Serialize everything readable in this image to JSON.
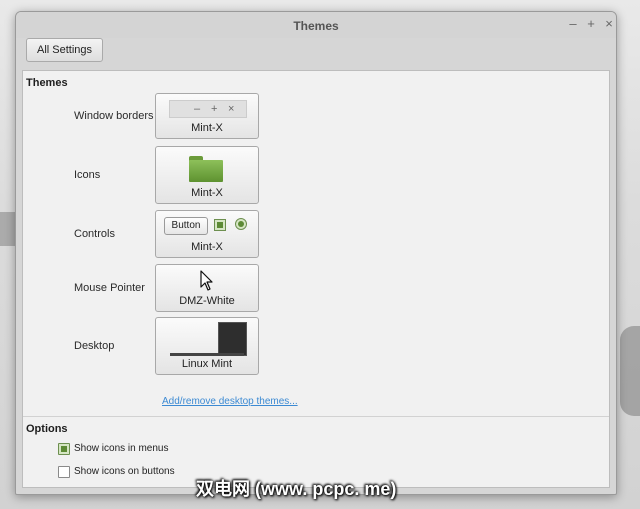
{
  "window": {
    "title": "Themes",
    "controls": {
      "minimize": "–",
      "maximize": "+",
      "close": "×"
    }
  },
  "toolbar": {
    "all_settings_label": "All Settings"
  },
  "themes_section": {
    "title": "Themes",
    "rows": [
      {
        "label": "Window borders",
        "value": "Mint-X",
        "preview_icon": "window-controls-icon"
      },
      {
        "label": "Icons",
        "value": "Mint-X",
        "preview_icon": "folder-icon"
      },
      {
        "label": "Controls",
        "value": "Mint-X",
        "preview_button_label": "Button"
      },
      {
        "label": "Mouse Pointer",
        "value": "DMZ-White",
        "preview_icon": "arrow-pointer-icon"
      },
      {
        "label": "Desktop",
        "value": "Linux Mint",
        "preview_icon": "desktop-preview-icon"
      }
    ],
    "add_remove_link": "Add/remove desktop themes..."
  },
  "options_section": {
    "title": "Options",
    "items": [
      {
        "label": "Show icons in menus",
        "checked": true
      },
      {
        "label": "Show icons on buttons",
        "checked": false
      }
    ]
  },
  "colors": {
    "accent_green": "#5d8a35",
    "link_blue": "#3c8ad3"
  },
  "watermark": "双电网 (www. pcpc. me)"
}
